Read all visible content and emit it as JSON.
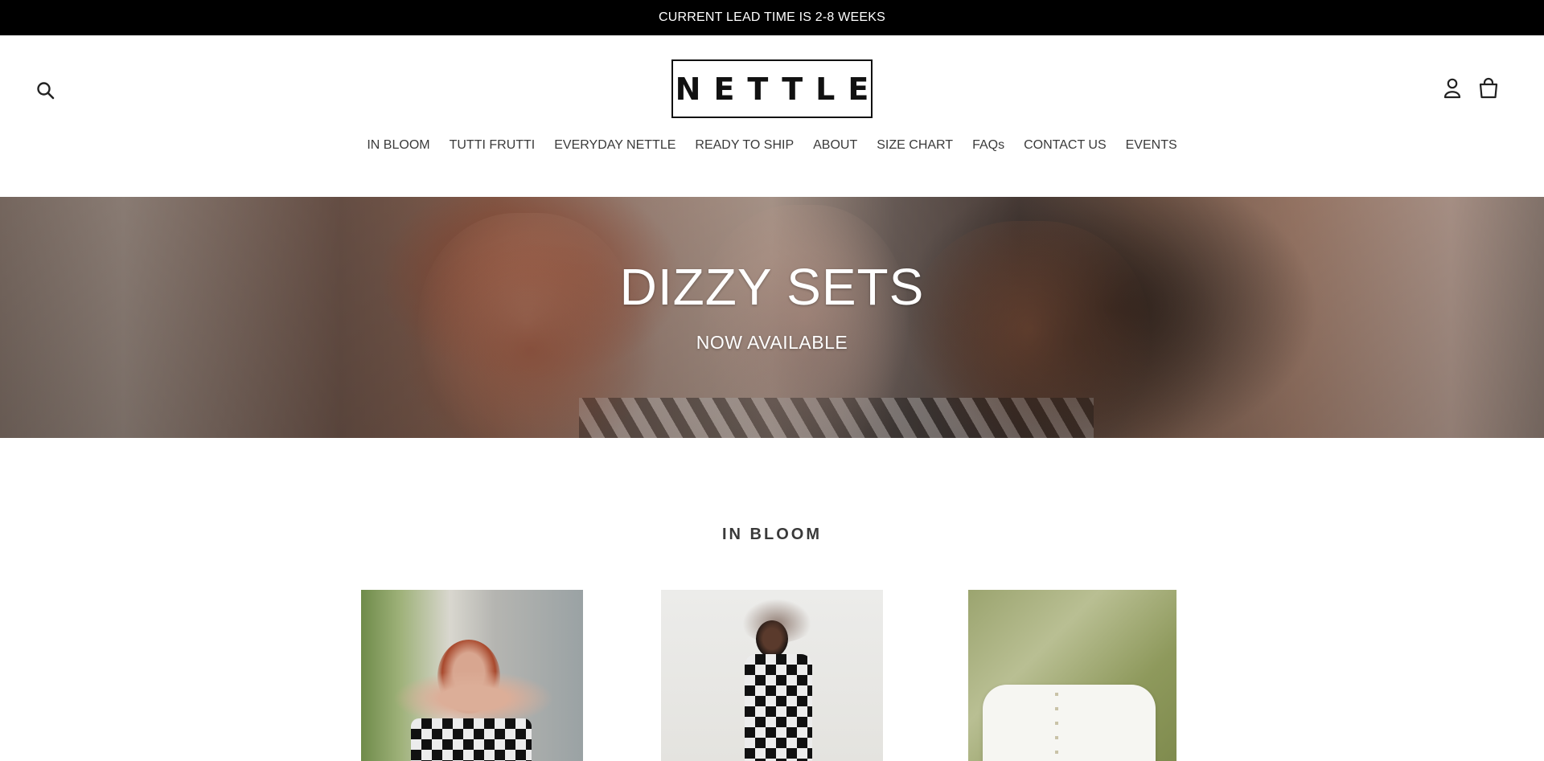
{
  "announcement": {
    "text": "CURRENT LEAD TIME IS 2-8 WEEKS"
  },
  "header": {
    "logo_text": "NETTLE",
    "icons": {
      "search": "search-icon",
      "account": "user-icon",
      "cart": "shopping-bag-icon"
    }
  },
  "nav": {
    "items": [
      {
        "label": "IN BLOOM"
      },
      {
        "label": "TUTTI FRUTTI"
      },
      {
        "label": "EVERYDAY NETTLE"
      },
      {
        "label": "READY TO SHIP"
      },
      {
        "label": "ABOUT"
      },
      {
        "label": "SIZE CHART"
      },
      {
        "label": "FAQs"
      },
      {
        "label": "CONTACT US"
      },
      {
        "label": "EVENTS"
      }
    ]
  },
  "hero": {
    "title": "DIZZY SETS",
    "subtitle": "NOW AVAILABLE"
  },
  "collection": {
    "title": "IN BLOOM"
  },
  "colors": {
    "announcement_bg": "#000000",
    "text": "#3a3a3a",
    "logo": "#111111"
  }
}
